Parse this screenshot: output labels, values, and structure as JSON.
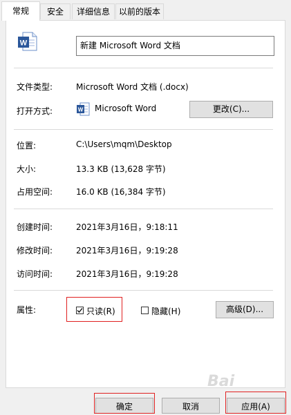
{
  "tabs": [
    {
      "label": "常规"
    },
    {
      "label": "安全"
    },
    {
      "label": "详细信息"
    },
    {
      "label": "以前的版本"
    }
  ],
  "file_name": "新建 Microsoft Word 文档",
  "file_type": {
    "label": "文件类型:",
    "value": "Microsoft Word 文档 (.docx)"
  },
  "open_with": {
    "label": "打开方式:",
    "value": "Microsoft Word",
    "change_button": "更改(C)..."
  },
  "location": {
    "label": "位置:",
    "value": "C:\\Users\\mqm\\Desktop"
  },
  "size": {
    "label": "大小:",
    "value": "13.3 KB (13,628 字节)"
  },
  "size_on_disk": {
    "label": "占用空间:",
    "value": "16.0 KB (16,384 字节)"
  },
  "created": {
    "label": "创建时间:",
    "value": "2021年3月16日，9:18:11"
  },
  "modified": {
    "label": "修改时间:",
    "value": "2021年3月16日，9:19:28"
  },
  "accessed": {
    "label": "访问时间:",
    "value": "2021年3月16日，9:19:28"
  },
  "attributes": {
    "label": "属性:",
    "readonly": {
      "label": "只读(R)",
      "checked": true
    },
    "hidden": {
      "label": "隐藏(H)",
      "checked": false
    },
    "advanced_button": "高级(D)..."
  },
  "footer": {
    "ok_button": "确定",
    "cancel_button": "取消",
    "apply_button": "应用(A)"
  },
  "watermark": "Bai"
}
